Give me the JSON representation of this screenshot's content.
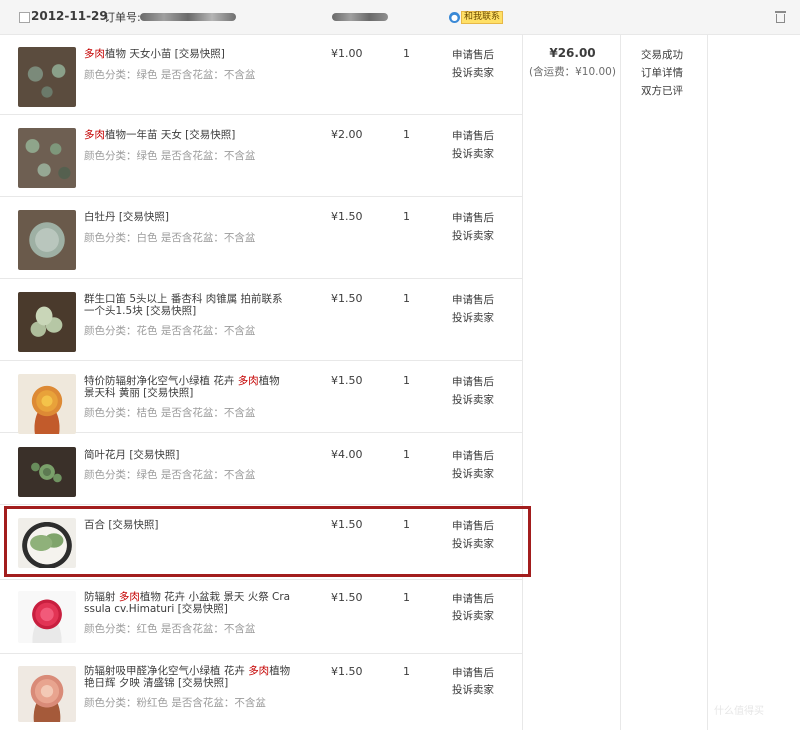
{
  "header": {
    "date": "2012-11-29",
    "order_label": "订单号:",
    "contact_badge": "和我联系",
    "contact_icon": "chat-bubble-icon",
    "trash_icon": "trash-icon"
  },
  "order": {
    "total": "¥26.00",
    "shipping": "(含运费：¥10.00)",
    "status_lines": [
      "交易成功",
      "订单详情",
      "双方已评"
    ]
  },
  "actions": {
    "after_sales": "申请售后",
    "complain": "投诉卖家"
  },
  "items": [
    {
      "title_parts": [
        "多肉",
        "植物 天女小苗 [交易快照]"
      ],
      "title2": "",
      "sub": "颜色分类：绿色  是否含花盆：不含盆",
      "price": "¥1.00",
      "qty": "1"
    },
    {
      "title_parts": [
        "多肉",
        "植物一年苗 天女 [交易快照]"
      ],
      "title2": "",
      "sub": "颜色分类：绿色  是否含花盆：不含盆",
      "price": "¥2.00",
      "qty": "1"
    },
    {
      "title_parts": [
        "",
        "白牡丹 [交易快照]"
      ],
      "title2": "",
      "sub": "颜色分类：白色  是否含花盆：不含盆",
      "price": "¥1.50",
      "qty": "1"
    },
    {
      "title_parts": [
        "",
        "群生口笛 5头以上 番杏科 肉锥属 拍前联系"
      ],
      "title2": "一个头1.5块 [交易快照]",
      "sub": "颜色分类：花色  是否含花盆：不含盆",
      "price": "¥1.50",
      "qty": "1"
    },
    {
      "title_parts": [
        "特价防辐射净化空气小绿植 花卉 ",
        "多肉",
        "植物"
      ],
      "title2": "景天科 黄丽 [交易快照]",
      "sub": "颜色分类：桔色  是否含花盆：不含盆",
      "price": "¥1.50",
      "qty": "1"
    },
    {
      "title_parts": [
        "",
        "简叶花月 [交易快照]"
      ],
      "title2": "",
      "sub": "颜色分类：绿色  是否含花盆：不含盆",
      "price": "¥4.00",
      "qty": "1"
    },
    {
      "title_parts": [
        "",
        "百合 [交易快照]"
      ],
      "title2": "",
      "sub": "",
      "price": "¥1.50",
      "qty": "1"
    },
    {
      "title_parts": [
        "防辐射 ",
        "多肉",
        "植物 花卉 小盆栽 景天 火祭 Cra"
      ],
      "title2": "ssula cv.Himaturi [交易快照]",
      "sub": "颜色分类：红色  是否含花盆：不含盆",
      "price": "¥1.50",
      "qty": "1"
    },
    {
      "title_parts": [
        "防辐射吸甲醛净化空气小绿植 花卉 ",
        "多肉",
        "植物"
      ],
      "title2": "艳日辉 夕映 清盛锦 [交易快照]",
      "sub": "颜色分类：粉红色  是否含花盆：不含盆",
      "price": "¥1.50",
      "qty": "1"
    }
  ],
  "watermark": "什么值得买"
}
